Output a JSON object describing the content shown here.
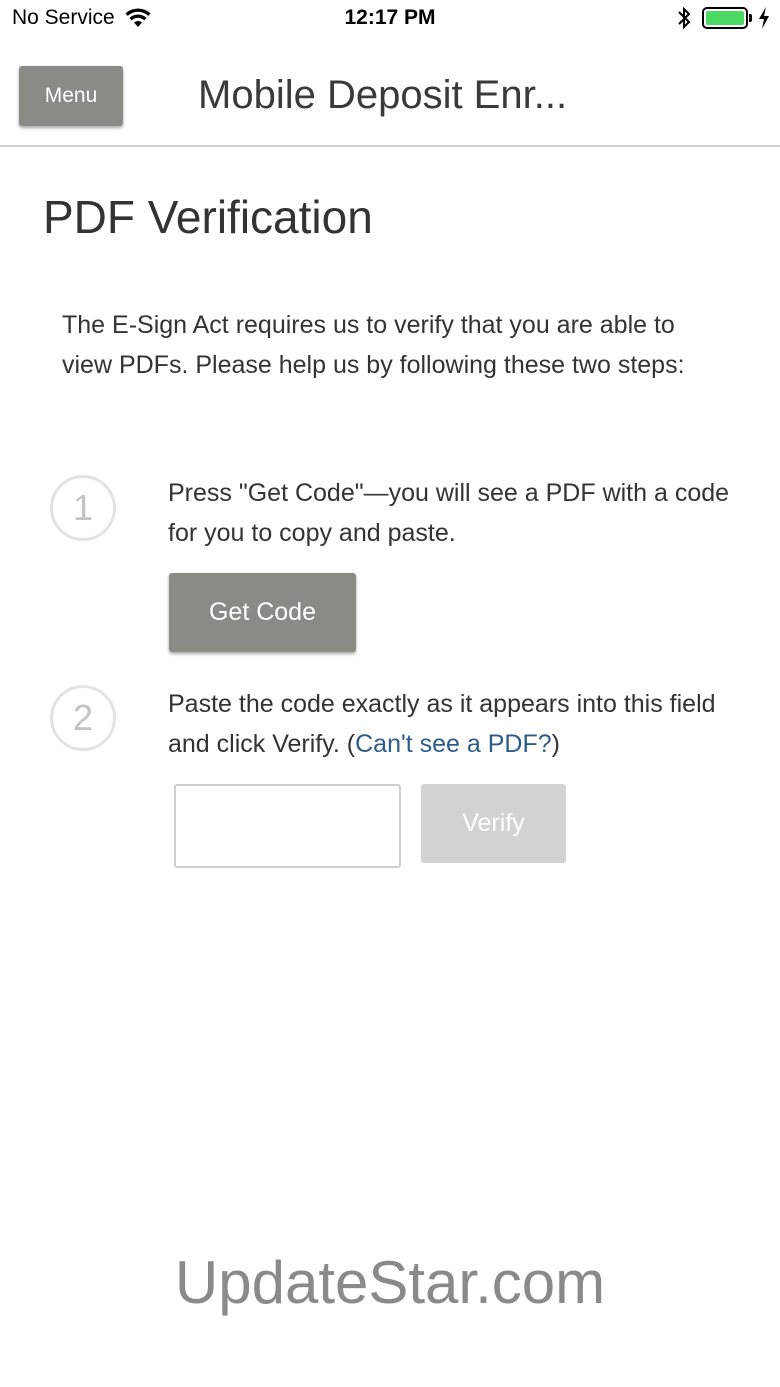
{
  "status_bar": {
    "carrier": "No Service",
    "time": "12:17 PM",
    "icons": [
      "wifi-icon",
      "bluetooth-icon",
      "battery-icon",
      "charging-icon"
    ],
    "battery_color": "#4cd964"
  },
  "header": {
    "menu_label": "Menu",
    "title": "Mobile Deposit Enr..."
  },
  "page": {
    "title": "PDF Verification",
    "intro": "The E-Sign Act requires us to verify that you are able to view PDFs. Please help us by following these two steps:"
  },
  "steps": [
    {
      "number": "1",
      "text": "Press \"Get Code\"—you will see a PDF with a code for you to copy and paste.",
      "button_label": "Get Code"
    },
    {
      "number": "2",
      "text_before": "Paste the code exactly as it appears into this field and click Verify. (",
      "link_text": "Can't see a PDF?",
      "text_after": ")",
      "input_value": "",
      "button_label": "Verify"
    }
  ],
  "colors": {
    "button_gray": "#8b8b86",
    "disabled_gray": "#d2d2d2",
    "link_blue": "#2e5c8a"
  },
  "watermark": "UpdateStar.com"
}
